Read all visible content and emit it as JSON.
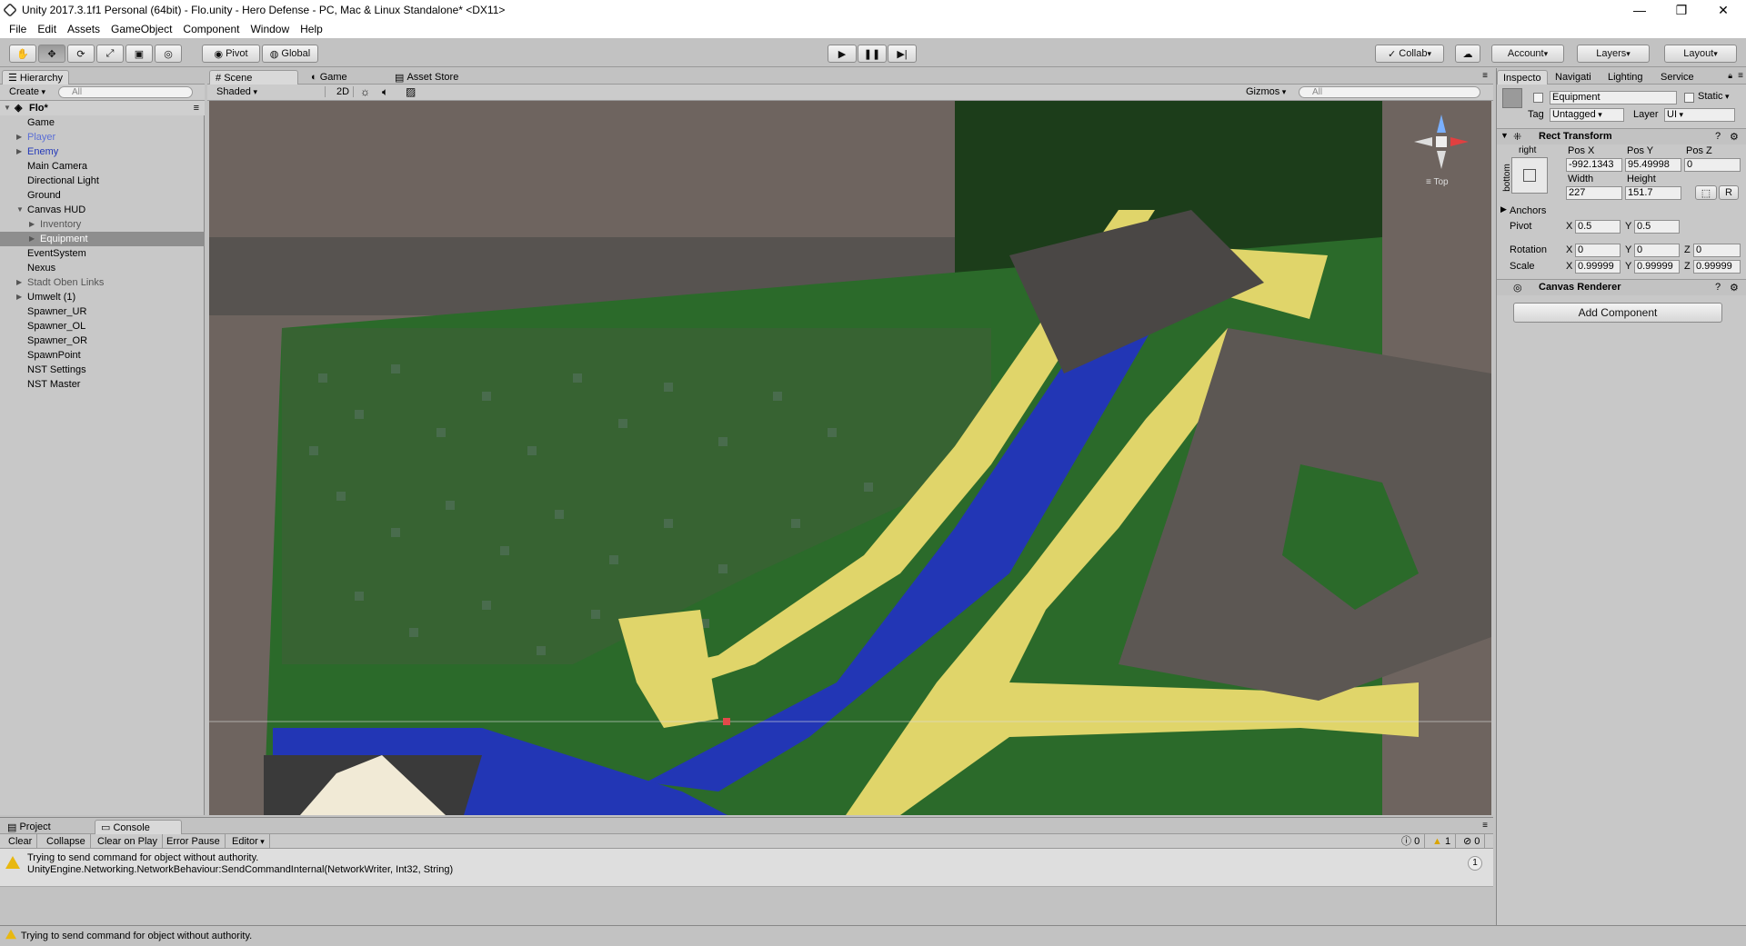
{
  "window": {
    "title": "Unity 2017.3.1f1 Personal (64bit) - Flo.unity - Hero Defense - PC, Mac & Linux Standalone* <DX11>"
  },
  "menu": [
    "File",
    "Edit",
    "Assets",
    "GameObject",
    "Component",
    "Window",
    "Help"
  ],
  "toolbar": {
    "pivot": "Pivot",
    "global": "Global",
    "collab": "Collab",
    "account": "Account",
    "layers": "Layers",
    "layout": "Layout"
  },
  "hierarchy": {
    "tab": "Hierarchy",
    "create": "Create",
    "search_placeholder": "All",
    "scene": "Flo*",
    "items": [
      {
        "label": "Game",
        "indent": 1,
        "arrow": false,
        "color": "#000"
      },
      {
        "label": "Player",
        "indent": 1,
        "arrow": true,
        "color": "#5b6fd6"
      },
      {
        "label": "Enemy",
        "indent": 1,
        "arrow": true,
        "color": "#2338b8"
      },
      {
        "label": "Main Camera",
        "indent": 1,
        "arrow": false,
        "color": "#000"
      },
      {
        "label": "Directional Light",
        "indent": 1,
        "arrow": false,
        "color": "#000"
      },
      {
        "label": "Ground",
        "indent": 1,
        "arrow": false,
        "color": "#000"
      },
      {
        "label": "Canvas HUD",
        "indent": 1,
        "arrow": true,
        "open": true,
        "color": "#000"
      },
      {
        "label": "Inventory",
        "indent": 2,
        "arrow": true,
        "color": "#555"
      },
      {
        "label": "Equipment",
        "indent": 2,
        "arrow": true,
        "color": "#fff",
        "selected": true
      },
      {
        "label": "EventSystem",
        "indent": 1,
        "arrow": false,
        "color": "#000"
      },
      {
        "label": "Nexus",
        "indent": 1,
        "arrow": false,
        "color": "#000"
      },
      {
        "label": "Stadt Oben Links",
        "indent": 1,
        "arrow": true,
        "color": "#555"
      },
      {
        "label": "Umwelt (1)",
        "indent": 1,
        "arrow": true,
        "color": "#000"
      },
      {
        "label": "Spawner_UR",
        "indent": 1,
        "arrow": false,
        "color": "#000"
      },
      {
        "label": "Spawner_OL",
        "indent": 1,
        "arrow": false,
        "color": "#000"
      },
      {
        "label": "Spawner_OR",
        "indent": 1,
        "arrow": false,
        "color": "#000"
      },
      {
        "label": "SpawnPoint",
        "indent": 1,
        "arrow": false,
        "color": "#000"
      },
      {
        "label": "NST Settings",
        "indent": 1,
        "arrow": false,
        "color": "#000"
      },
      {
        "label": "NST Master",
        "indent": 1,
        "arrow": false,
        "color": "#000"
      }
    ]
  },
  "scene": {
    "tab_scene": "Scene",
    "tab_game": "Game",
    "tab_store": "Asset Store",
    "shading": "Shaded",
    "mode2d": "2D",
    "gizmos": "Gizmos",
    "search_placeholder": "All",
    "orientation": "Top"
  },
  "inspector": {
    "tabs": [
      "Inspecto",
      "Navigati",
      "Lighting",
      "Service"
    ],
    "name": "Equipment",
    "static": "Static",
    "tag_label": "Tag",
    "tag": "Untagged",
    "layer_label": "Layer",
    "layer": "UI",
    "rect_transform": "Rect Transform",
    "anchor_h": "right",
    "anchor_v": "bottom",
    "posx_label": "Pos X",
    "posy_label": "Pos Y",
    "posz_label": "Pos Z",
    "posx": "-992.1343",
    "posy": "95.49998",
    "posz": "0",
    "width_label": "Width",
    "height_label": "Height",
    "width": "227",
    "height": "151.7",
    "r_btn": "R",
    "anchors": "Anchors",
    "pivot_label": "Pivot",
    "pivot_x": "0.5",
    "pivot_y": "0.5",
    "rotation_label": "Rotation",
    "rot_x": "0",
    "rot_y": "0",
    "rot_z": "0",
    "scale_label": "Scale",
    "scale_x": "0.99999",
    "scale_y": "0.99999",
    "scale_z": "0.99999",
    "x": "X",
    "y": "Y",
    "z": "Z",
    "canvas_renderer": "Canvas Renderer",
    "add_component": "Add Component"
  },
  "console": {
    "tab_project": "Project",
    "tab_console": "Console",
    "clear": "Clear",
    "collapse": "Collapse",
    "clear_on_play": "Clear on Play",
    "error_pause": "Error Pause",
    "editor": "Editor",
    "count_log": "0",
    "count_warn": "1",
    "count_err": "0",
    "msg1": "Trying to send command for object without authority.",
    "msg2": "UnityEngine.Networking.NetworkBehaviour:SendCommandInternal(NetworkWriter, Int32, String)",
    "msg_count": "1"
  },
  "status": {
    "text": "Trying to send command for object without authority."
  }
}
